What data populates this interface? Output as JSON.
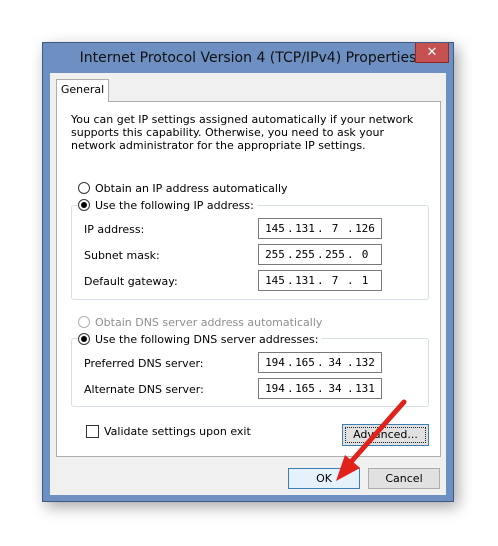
{
  "window": {
    "title": "Internet Protocol Version 4 (TCP/IPv4) Properties",
    "close_glyph": "✕"
  },
  "tabs": [
    {
      "label": "General",
      "selected": true
    }
  ],
  "description": "You can get IP settings assigned automatically if your network supports this capability. Otherwise, you need to ask your network administrator for the appropriate IP settings.",
  "ip_mode": {
    "auto": {
      "label": "Obtain an IP address automatically",
      "checked": false
    },
    "manual": {
      "label": "Use the following IP address:",
      "checked": true
    }
  },
  "ip_fields": [
    {
      "label": "IP address:",
      "value": [
        "145",
        "131",
        "7",
        "126"
      ]
    },
    {
      "label": "Subnet mask:",
      "value": [
        "255",
        "255",
        "255",
        "0"
      ]
    },
    {
      "label": "Default gateway:",
      "value": [
        "145",
        "131",
        "7",
        "1"
      ]
    }
  ],
  "dns_mode": {
    "auto": {
      "label": "Obtain DNS server address automatically",
      "checked": false,
      "disabled": true
    },
    "manual": {
      "label": "Use the following DNS server addresses:",
      "checked": true
    }
  },
  "dns_fields": [
    {
      "label": "Preferred DNS server:",
      "value": [
        "194",
        "165",
        "34",
        "132"
      ]
    },
    {
      "label": "Alternate DNS server:",
      "value": [
        "194",
        "165",
        "34",
        "131"
      ]
    }
  ],
  "validate": {
    "label": "Validate settings upon exit",
    "checked": false
  },
  "buttons": {
    "advanced": "Advanced...",
    "ok": "OK",
    "cancel": "Cancel"
  },
  "colors": {
    "titlebar": "#6d8fc1",
    "close": "#c75050",
    "arrow": "#e0221a"
  }
}
